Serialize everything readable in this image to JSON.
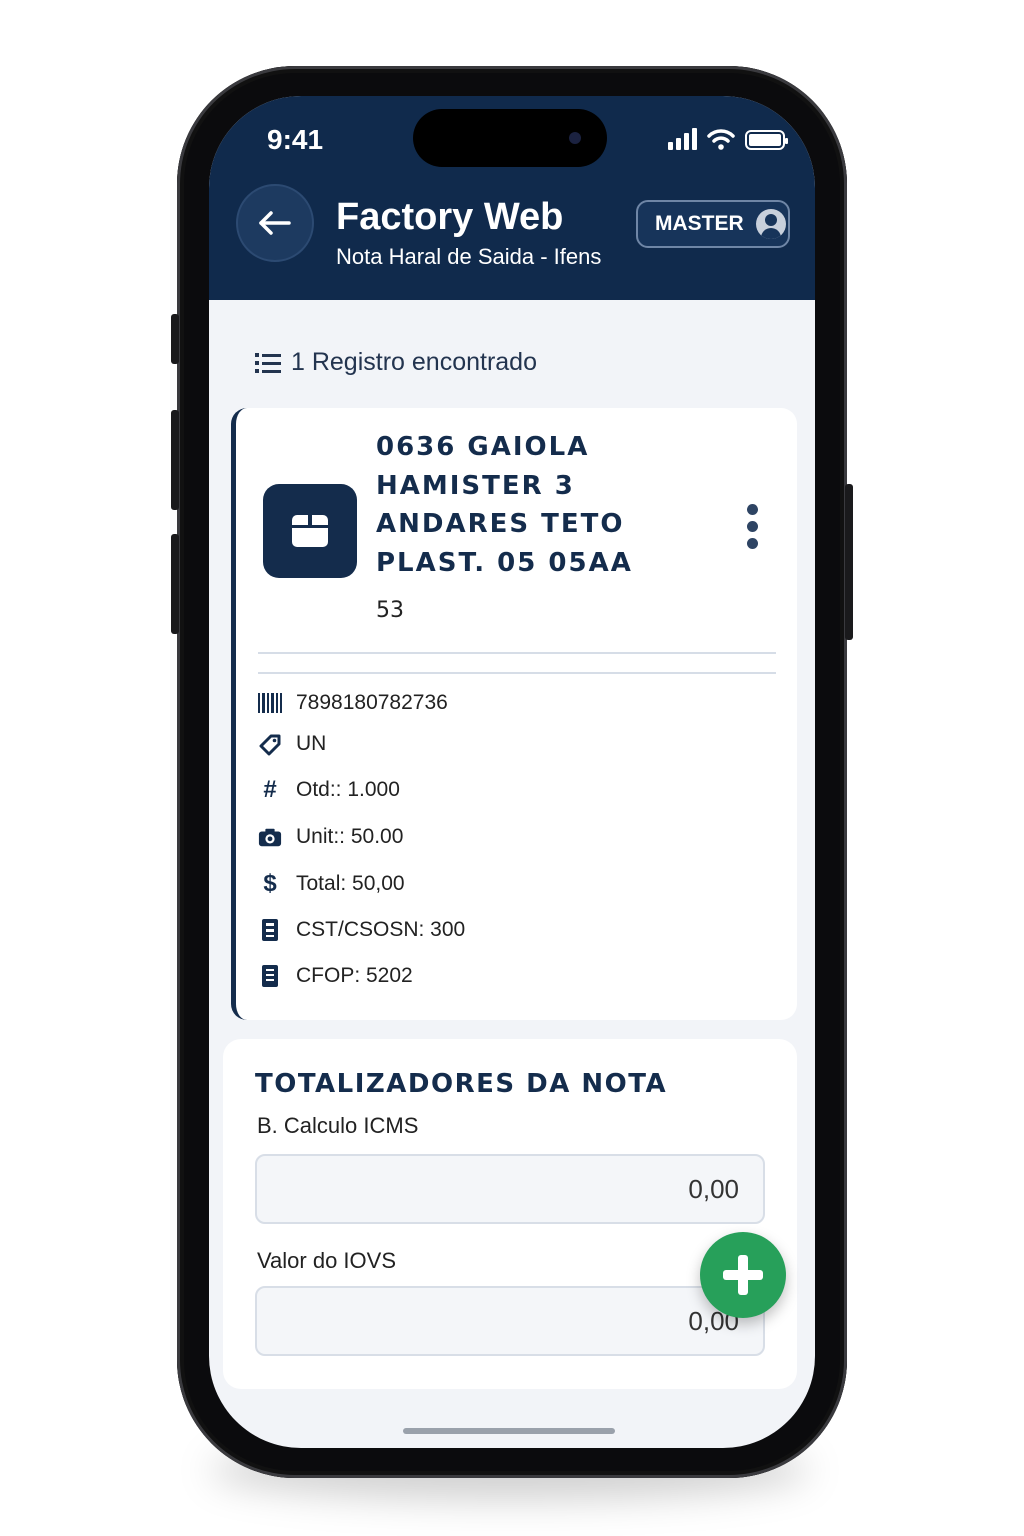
{
  "status_bar": {
    "time": "9:41"
  },
  "header": {
    "title": "Factory Web",
    "subtitle": "Nota Haral de Saida - Ifens",
    "user_label": "MASTER"
  },
  "records": {
    "count_label": "1 Registro encontrado"
  },
  "item": {
    "name_lines": [
      "0636 GAIOLA",
      "HAMISTER 3",
      "ANDARES TETO",
      "PLAST. 05 05AA"
    ],
    "code": "53",
    "barcode": "7898180782736",
    "unit": "UN",
    "qty": "Otd:: 1.000",
    "unit_price": "Unit:: 50.00",
    "total": "Total: 50,00",
    "cst": "CST/CSOSN: 300",
    "cfop": "CFOP: 5202"
  },
  "totals": {
    "title": "TOTALIZADORES DA NOTA",
    "icms_base_label": "B. Calculo ICMS",
    "icms_base_value": "0,00",
    "iovs_label": "Valor do IOVS",
    "iovs_value": "0,00"
  },
  "icons": {
    "back": "arrow-left-icon",
    "list": "list-icon",
    "box": "box-icon",
    "menu": "more-vertical-icon",
    "barcode": "barcode-icon",
    "unit": "tag-icon",
    "qty": "hash-icon",
    "unit_price": "camera-icon",
    "total": "dollar-icon",
    "cst": "document-icon",
    "cfop": "document-icon",
    "fab": "plus-icon"
  },
  "colors": {
    "header_bg": "#102a4c",
    "primary": "#142c4c",
    "fab": "#27a05a"
  }
}
